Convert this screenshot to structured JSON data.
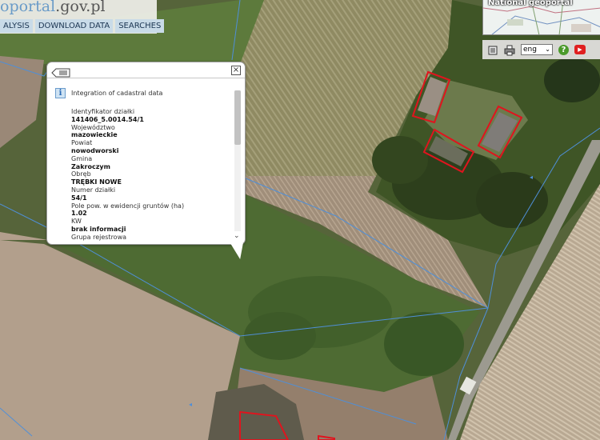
{
  "logo": {
    "part1": "oportal",
    "part2": ".gov.pl"
  },
  "toolbar": {
    "items": [
      "ALYSIS",
      "DOWNLOAD DATA",
      "SEARCHES"
    ]
  },
  "minimap": {
    "title": "National geoportal"
  },
  "controls": {
    "language": "eng"
  },
  "popup": {
    "section_title": "Integration of cadastral data",
    "fields": [
      {
        "label": "Identyfikator działki",
        "value": "141406_5.0014.54/1"
      },
      {
        "label": "Województwo",
        "value": "mazowieckie"
      },
      {
        "label": "Powiat",
        "value": "nowodworski"
      },
      {
        "label": "Gmina",
        "value": "Zakroczym"
      },
      {
        "label": "Obręb",
        "value": "TRĘBKI NOWE"
      },
      {
        "label": "Numer działki",
        "value": "54/1"
      },
      {
        "label": "Pole pow. w ewidencji gruntów (ha)",
        "value": "1.02"
      },
      {
        "label": "KW",
        "value": "brak informacji"
      },
      {
        "label": "Grupa rejestrowa",
        "value": ""
      }
    ]
  },
  "colors": {
    "cadastral_line": "#4f8fd8",
    "building_outline": "#e0141e",
    "toolbar_button": "#c9dbe8"
  }
}
